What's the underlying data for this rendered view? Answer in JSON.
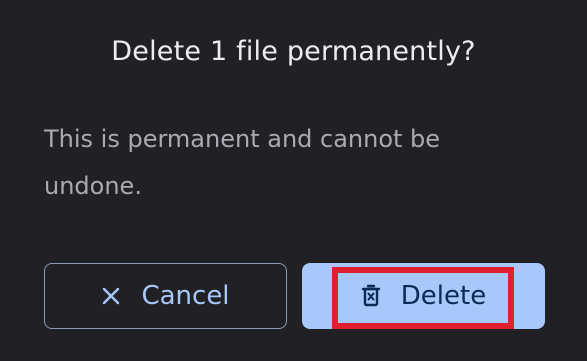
{
  "dialog": {
    "title": "Delete 1 file permanently?",
    "message": "This is permanent and cannot be undone."
  },
  "buttons": {
    "cancel_label": "Cancel",
    "cancel_icon": "close-icon",
    "delete_label": "Delete",
    "delete_icon": "trash-icon"
  },
  "colors": {
    "background": "#212125",
    "accent": "#a8c7fa",
    "highlight": "#e0202e"
  }
}
